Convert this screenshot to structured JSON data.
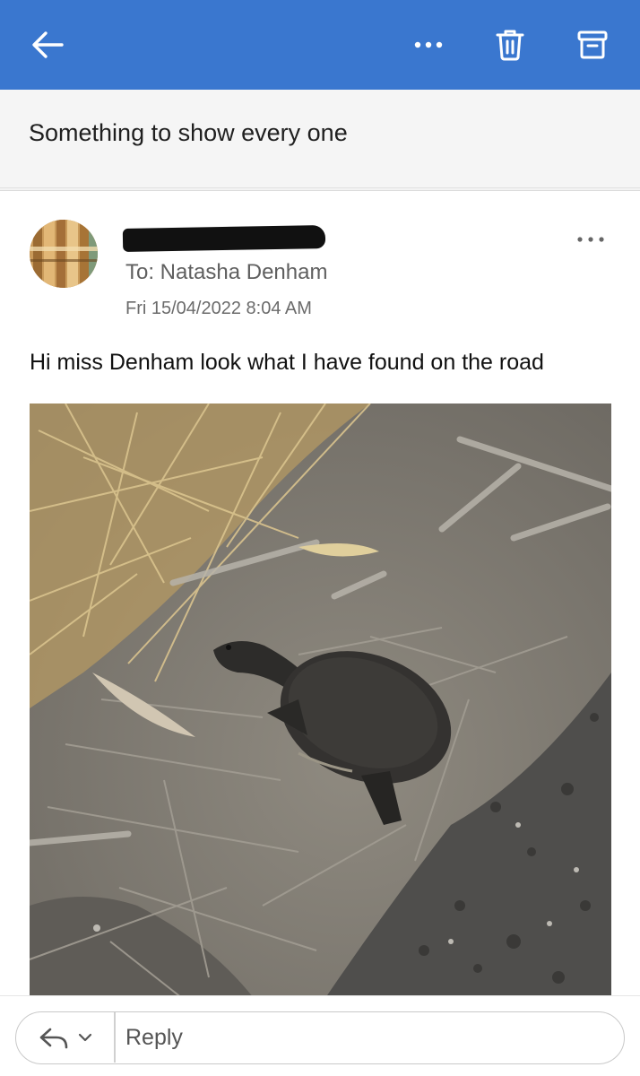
{
  "toolbar": {
    "back_icon": "back-arrow-icon",
    "more_icon": "more-horizontal-icon",
    "delete_icon": "trash-icon",
    "archive_icon": "archive-icon",
    "accent_color": "#3a77cf"
  },
  "email": {
    "subject": "Something to show every one",
    "sender_redacted": true,
    "to": "To: Natasha Denham",
    "date": "Fri 15/04/2022 8:04 AM",
    "body": "Hi miss Denham look what I have found on the road",
    "attachment_image": "turtle-on-roadside-photo"
  },
  "reply": {
    "label": "Reply",
    "reply_icon": "reply-arrow-icon",
    "dropdown_icon": "chevron-down-icon"
  }
}
